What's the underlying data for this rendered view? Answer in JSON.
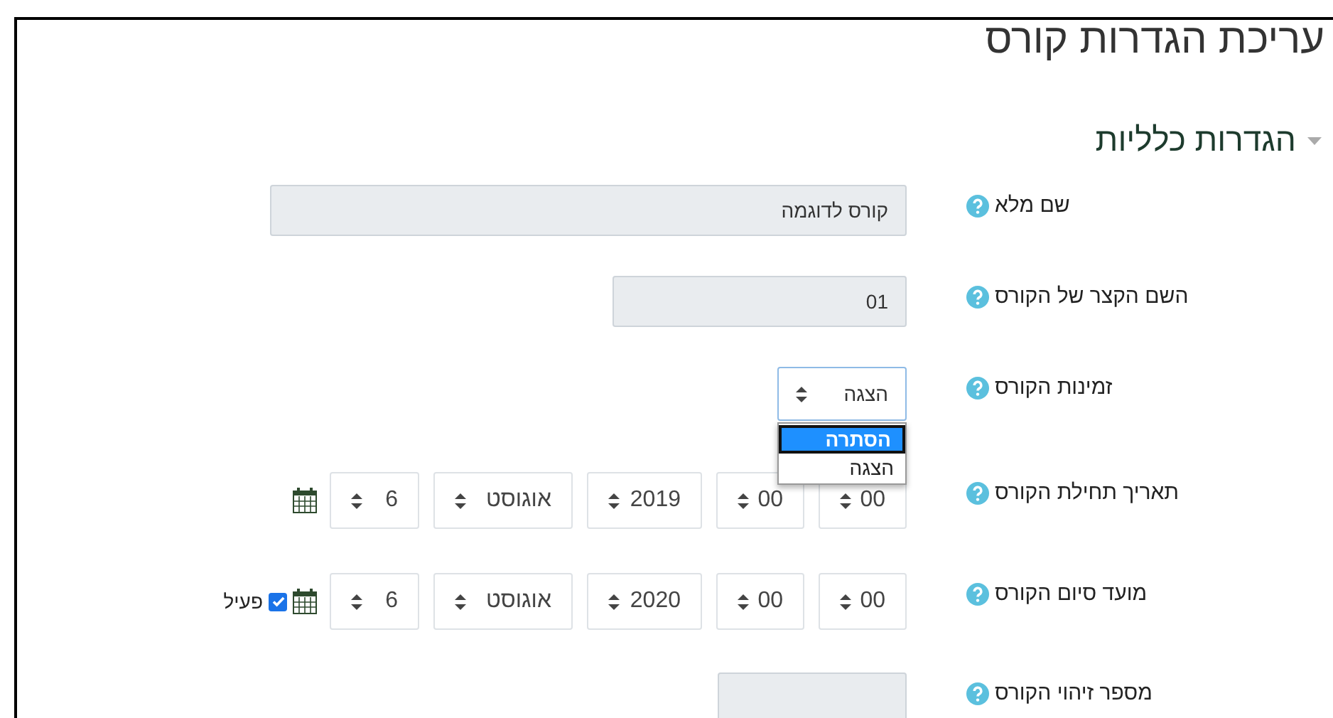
{
  "page_title": "עריכת הגדרות קורס",
  "section": {
    "title": "הגדרות כלליות",
    "expanded": true
  },
  "fields": [
    {
      "kind": "text",
      "label": "שם מלא",
      "value": "קורס לדוגמה"
    },
    {
      "kind": "short",
      "label": "השם הקצר של הקורס",
      "value": "01"
    },
    {
      "kind": "select",
      "label": "זמינות הקורס",
      "value": "הצגה",
      "open": true,
      "options": [
        {
          "label": "הסתרה",
          "highlighted": true
        },
        {
          "label": "הצגה",
          "highlighted": false
        }
      ]
    },
    {
      "kind": "date",
      "label": "תאריך תחילת הקורס",
      "parts": [
        "00",
        "00",
        "2019",
        "אוגוסט",
        "6"
      ]
    },
    {
      "kind": "date",
      "label": "מועד סיום הקורס",
      "parts": [
        "00",
        "00",
        "2020",
        "אוגוסט",
        "6"
      ],
      "enable": {
        "label": "פעיל",
        "checked": true
      }
    },
    {
      "kind": "short",
      "label": "מספר זיהוי הקורס"
    }
  ]
}
